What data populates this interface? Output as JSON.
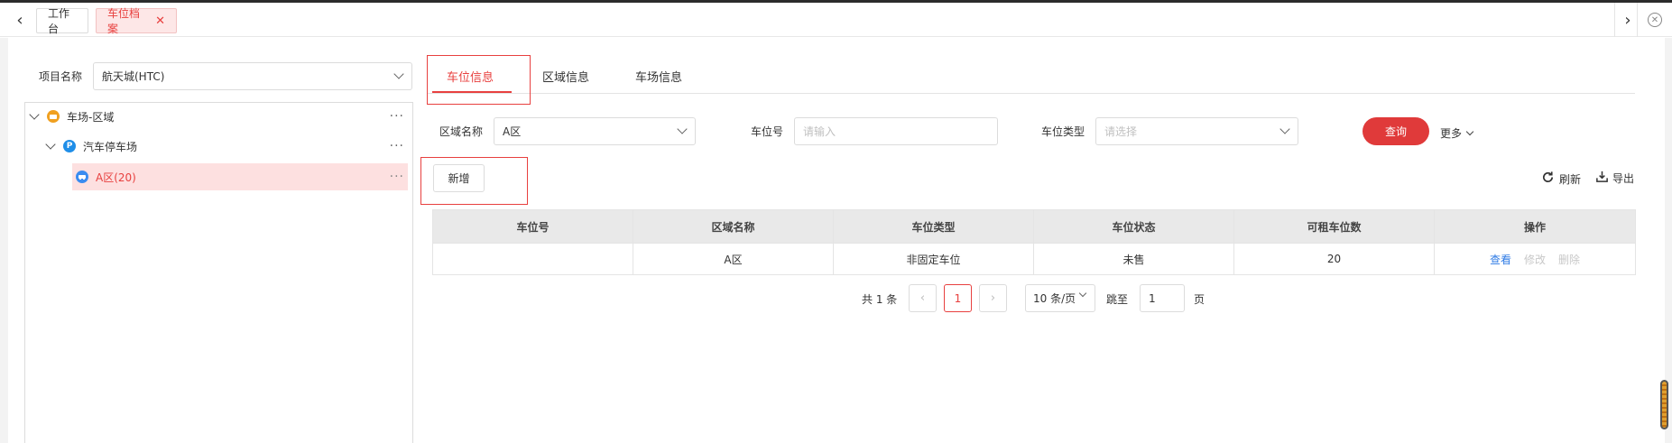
{
  "tabs": {
    "items": [
      {
        "label": "工作台"
      },
      {
        "label": "车位档案",
        "close": "✕"
      }
    ]
  },
  "filter_left": {
    "project_label": "项目名称",
    "project_value": "航天城(HTC)"
  },
  "tree": {
    "nodes": [
      {
        "label": "车场-区域",
        "icon": "parking-lot-icon"
      },
      {
        "label": "汽车停车场",
        "icon": "parking-p-icon",
        "icon_text": "P"
      },
      {
        "label": "A区(20)",
        "icon": "car-icon"
      }
    ],
    "more": "···"
  },
  "subtabs": [
    {
      "label": "车位信息"
    },
    {
      "label": "区域信息"
    },
    {
      "label": "车场信息"
    }
  ],
  "search": {
    "area_label": "区域名称",
    "area_value": "A区",
    "space_no_label": "车位号",
    "space_no_placeholder": "请输入",
    "space_type_label": "车位类型",
    "space_type_placeholder": "请选择",
    "query_button": "查询",
    "more_label": "更多"
  },
  "toolbar": {
    "add_button": "新增",
    "refresh_label": "刷新",
    "export_label": "导出"
  },
  "table": {
    "headers": [
      "车位号",
      "区域名称",
      "车位类型",
      "车位状态",
      "可租车位数",
      "操作"
    ],
    "rows": [
      {
        "space_no": "",
        "area": "A区",
        "type": "非固定车位",
        "status": "未售",
        "rentable": "20"
      }
    ],
    "actions": {
      "view": "查看",
      "edit": "修改",
      "delete": "删除"
    }
  },
  "pagination": {
    "total_text": "共 1 条",
    "current_page": "1",
    "page_size": "10 条/页",
    "goto_label": "跳至",
    "goto_value": "1",
    "page_suffix": "页"
  },
  "colors": {
    "accent": "#e8403f",
    "link": "#2f7be5",
    "disabled": "#c8c8c8"
  }
}
